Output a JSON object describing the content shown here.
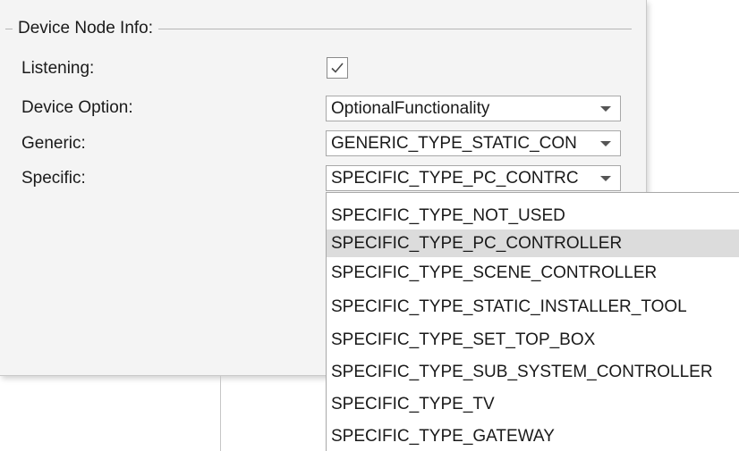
{
  "groupbox": {
    "title": "Device Node Info:"
  },
  "fields": {
    "listening": {
      "label": "Listening:",
      "checked": true
    },
    "device_option": {
      "label": "Device Option:",
      "value": "OptionalFunctionality"
    },
    "generic": {
      "label": "Generic:",
      "value": "GENERIC_TYPE_STATIC_CON"
    },
    "specific": {
      "label": "Specific:",
      "value": "SPECIFIC_TYPE_PC_CONTRC"
    }
  },
  "dropdown": {
    "items": [
      {
        "label": "SPECIFIC_TYPE_NOT_USED",
        "selected": false
      },
      {
        "label": "SPECIFIC_TYPE_PC_CONTROLLER",
        "selected": true
      },
      {
        "label": "SPECIFIC_TYPE_SCENE_CONTROLLER",
        "selected": false
      },
      {
        "label": "SPECIFIC_TYPE_STATIC_INSTALLER_TOOL",
        "selected": false
      },
      {
        "label": "SPECIFIC_TYPE_SET_TOP_BOX",
        "selected": false
      },
      {
        "label": "SPECIFIC_TYPE_SUB_SYSTEM_CONTROLLER",
        "selected": false
      },
      {
        "label": "SPECIFIC_TYPE_TV",
        "selected": false
      },
      {
        "label": "SPECIFIC_TYPE_GATEWAY",
        "selected": false
      }
    ]
  },
  "icons": {
    "checkmark": "check-icon",
    "dropdown_arrow": "chevron-down-icon"
  },
  "colors": {
    "panel_background": "#f4f4f4",
    "selected_item_background": "#dcdcdc",
    "border": "#a8a8a8"
  }
}
